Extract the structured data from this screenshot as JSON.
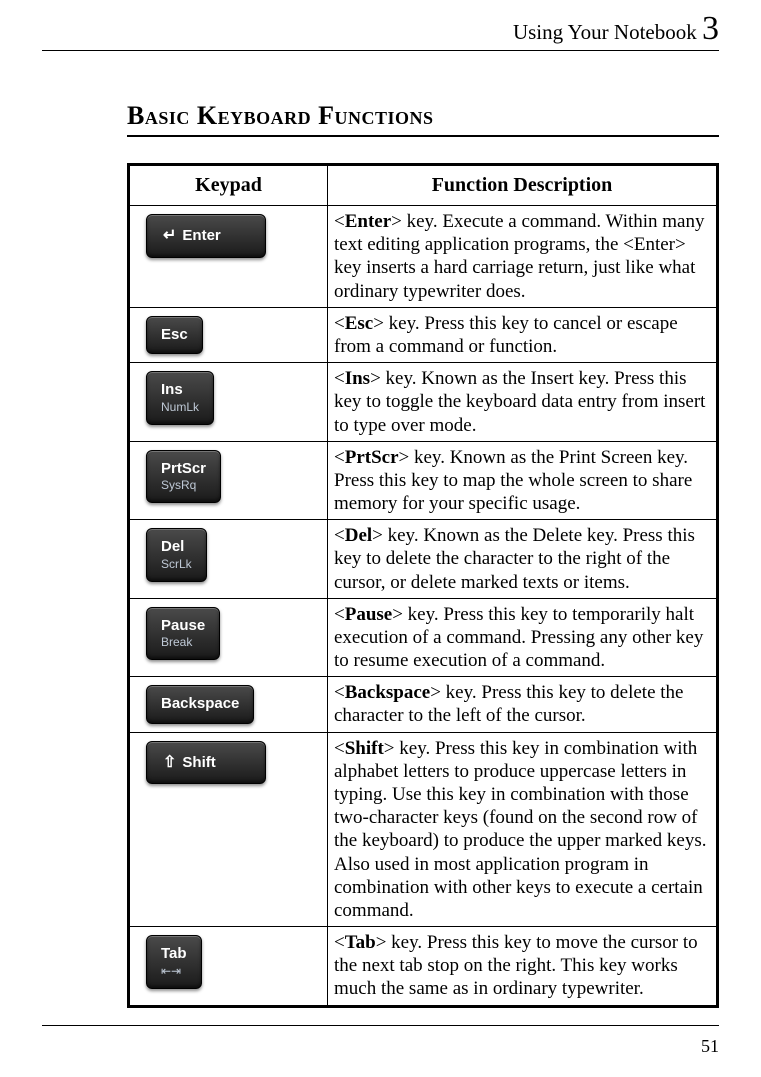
{
  "running_head": {
    "title": "Using Your Notebook",
    "chapter_number": "3"
  },
  "section_title": "Basic Keyboard Functions",
  "table": {
    "headers": {
      "keypad": "Keypad",
      "desc": "Function Description"
    },
    "rows": [
      {
        "key_label": "Enter",
        "key_sub": "",
        "key_glyph": "↵",
        "key_class": "wide",
        "desc_key": "Enter",
        "desc_rest": "> key. Execute a command. Within many text editing application programs, the <Enter> key inserts a hard carriage return, just like what ordinary typewriter does."
      },
      {
        "key_label": "Esc",
        "key_sub": "",
        "key_glyph": "",
        "key_class": "",
        "desc_key": "Esc",
        "desc_rest": "> key. Press this key to cancel or escape from a command or function."
      },
      {
        "key_label": "Ins",
        "key_sub": "NumLk",
        "key_glyph": "",
        "key_class": "",
        "desc_key": "Ins",
        "desc_rest": "> key. Known as the Insert key. Press this key to toggle the keyboard data entry from insert to type over mode."
      },
      {
        "key_label": "PrtScr",
        "key_sub": "SysRq",
        "key_glyph": "",
        "key_class": "",
        "desc_key": "PrtScr",
        "desc_rest": "> key. Known as the Print Screen key. Press this key to map the whole screen to share memory for your specific usage."
      },
      {
        "key_label": "Del",
        "key_sub": "ScrLk",
        "key_glyph": "",
        "key_class": "",
        "desc_key": "Del",
        "desc_rest": "> key. Known as the Delete key. Press this key to delete the character to the right of the cursor, or delete marked texts or items."
      },
      {
        "key_label": "Pause",
        "key_sub": "Break",
        "key_glyph": "",
        "key_class": "",
        "desc_key": "Pause",
        "desc_rest": "> key. Press this key to temporarily halt execution of a command. Pressing any other key to resume execution of a command."
      },
      {
        "key_label": "Backspace",
        "key_sub": "",
        "key_glyph": "",
        "key_class": "med",
        "desc_key": "Backspace",
        "desc_rest": "> key. Press this key to delete the character to the left of the cursor."
      },
      {
        "key_label": "Shift",
        "key_sub": "",
        "key_glyph": "⇧",
        "key_class": "wide",
        "desc_key": "Shift",
        "desc_rest": "> key. Press this key in combination with alphabet letters to produce uppercase letters in typing. Use this key in combination with those two-character keys (found on the second row of the keyboard) to produce the upper marked keys. Also used in most application program in combination with other keys to execute a certain command."
      },
      {
        "key_label": "Tab",
        "key_sub": "⇤⇥",
        "key_glyph": "",
        "key_class": "",
        "desc_key": "Tab",
        "desc_rest": "> key. Press this key to move the cursor to the next tab stop on the right. This key works much the same as in ordinary typewriter."
      }
    ]
  },
  "page_number": "51"
}
